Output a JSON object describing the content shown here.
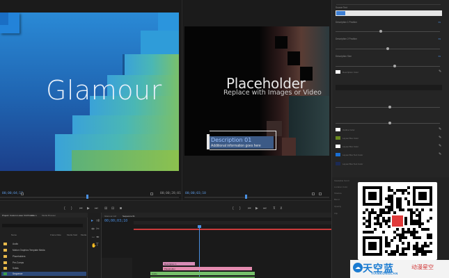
{
  "source_monitor": {
    "video_title": "Glamour",
    "timecode": "00;00;04;17"
  },
  "program_monitor": {
    "placeholder_title": "Placeholder",
    "placeholder_subtitle": "Replace with Images or Video",
    "description_title": "Description 01",
    "description_info": "Additional information goes here",
    "timecode": "00;00;03;10",
    "duration": "00;00;28;01"
  },
  "controls_panel": {
    "source_text_label": "Source Text",
    "params": [
      {
        "label": "Description 1 Position",
        "value": "69"
      },
      {
        "label": "Description 2 Position",
        "value": "69"
      },
      {
        "label": "Description Size",
        "value": "69"
      }
    ],
    "swatches": [
      {
        "label": "Description Color",
        "color": "#ffffff"
      },
      {
        "label": "Outline Color",
        "color": "#ffffff"
      },
      {
        "label": "Layout Box Color",
        "color": "#6b8a1f"
      },
      {
        "label": "Layout Box Color",
        "color": "#ffffff"
      },
      {
        "label": "Layout Box Text Color",
        "color": "#1a6fd4"
      },
      {
        "label": "Layout Box Text Color",
        "color": "#1b2a55"
      }
    ]
  },
  "lower_right_panel": {
    "items": [
      "Stackable Scroll",
      "Location Color",
      "Shadow",
      "Blend",
      "Opacity",
      "Clip"
    ]
  },
  "project_panel": {
    "title": "Project: Custom Lower 3rd Presets",
    "tabs": [
      "Effects",
      "Media Browser"
    ],
    "columns": [
      "Name",
      "Frame Rate",
      "Media Start",
      "Media"
    ],
    "items": [
      {
        "name": "Audio",
        "type": "folder"
      },
      {
        "name": "Motion Graphics Template Media",
        "type": "folder"
      },
      {
        "name": "Placeholders",
        "type": "folder"
      },
      {
        "name": "Pre-Comps",
        "type": "folder"
      },
      {
        "name": "Solids",
        "type": "folder"
      },
      {
        "name": "Sequence",
        "type": "sequence"
      }
    ]
  },
  "timeline": {
    "tabs": [
      "Glamour.mxf",
      "Sequence 01"
    ],
    "clips": [
      {
        "label": "Description 1",
        "color": "#d68bb5"
      },
      {
        "label": "Placeholder",
        "color": "#e48bb0"
      },
      {
        "label": "Audio",
        "color": "#76c06a"
      }
    ]
  },
  "brand": {
    "name_cn": "天空蓝",
    "tagline_cn": "动漫星空",
    "name_en": "TIANKONGLAN"
  }
}
